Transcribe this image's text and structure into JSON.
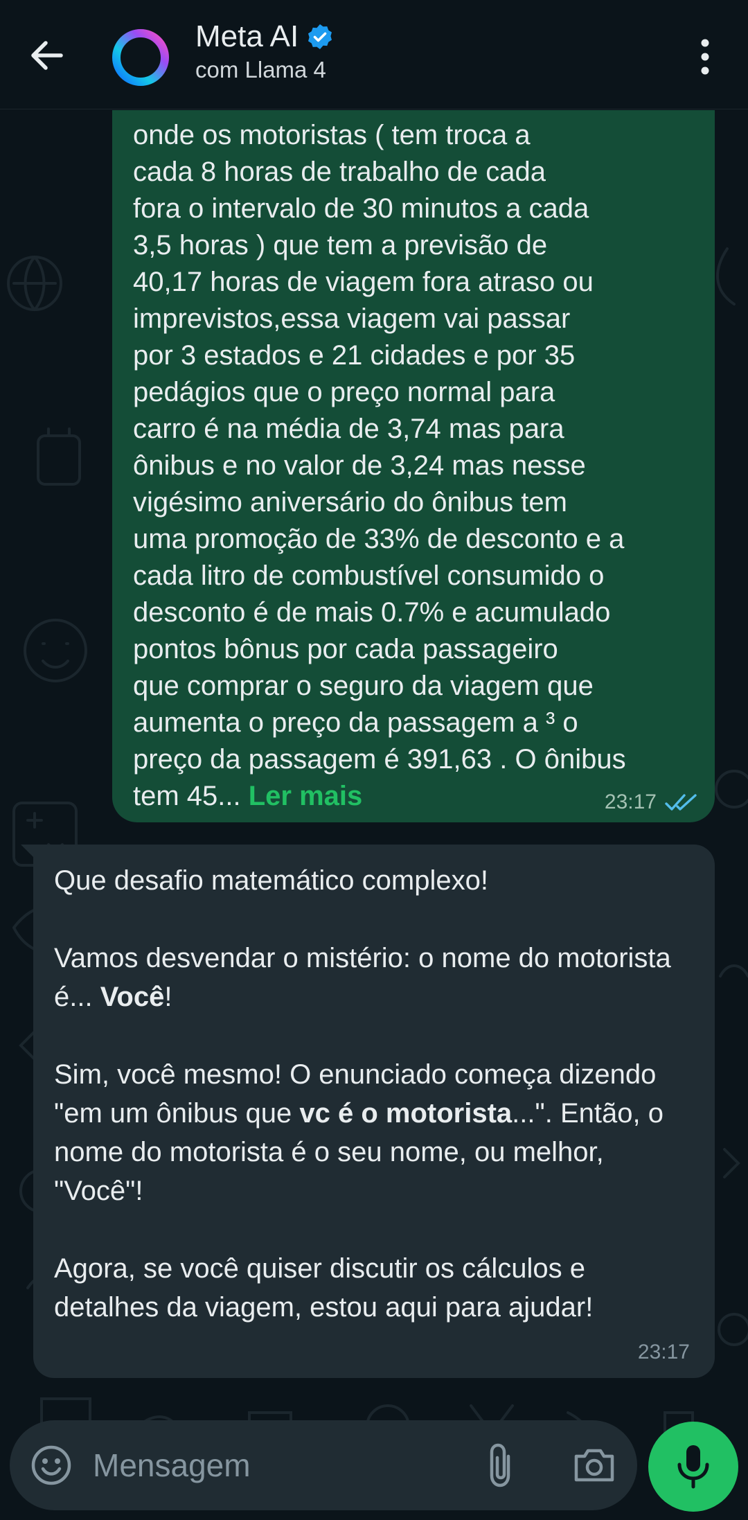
{
  "header": {
    "back_icon": "arrow-left-icon",
    "title": "Meta AI",
    "subtitle": "com Llama 4",
    "verified_icon": "verified-badge-icon",
    "menu_icon": "more-vertical-icon"
  },
  "messages": {
    "outgoing": {
      "text": "onde os motoristas ( tem troca a\ncada 8 horas de trabalho de cada\nfora o intervalo de 30 minutos a cada\n3,5 horas ) que tem a previsão de\n40,17 horas de viagem fora atraso ou\nimprevistos,essa viagem vai passar\npor 3 estados e 21 cidades e por 35\npedágios que o preço normal para\ncarro é na média de 3,74 mas para\nônibus e no valor de 3,24 mas nesse\nvigésimo aniversário do ônibus tem\numa promoção de 33% de desconto e a\ncada litro de combustível consumido o\ndesconto é de mais 0.7% e acumulado\npontos bônus por cada passageiro\nque comprar o seguro da viagem que\naumenta o preço da passagem a ³ o\npreço da passagem é 391,63 . O ônibus\ntem 45... ",
      "read_more": "Ler mais",
      "time": "23:17",
      "status_icon": "double-check-read-icon"
    },
    "incoming": {
      "p1": "Que desafio matemático complexo!",
      "p2_a": "Vamos desvendar o mistério: o nome do motorista é... ",
      "p2_bold": "Você",
      "p2_b": "!",
      "p3_a": "Sim, você mesmo! O enunciado começa dizendo \"em um ônibus que ",
      "p3_bold": "vc é o motorista",
      "p3_b": "...\". Então, o nome do motorista é o seu nome, ou melhor, \"Você\"!",
      "p4": "Agora, se você quiser discutir os cálculos e detalhes da viagem, estou aqui para ajudar!",
      "time": "23:17"
    }
  },
  "input": {
    "placeholder": "Mensagem",
    "emoji_icon": "emoji-icon",
    "attach_icon": "paperclip-icon",
    "camera_icon": "camera-icon",
    "mic_icon": "microphone-icon"
  },
  "colors": {
    "background": "#0b141a",
    "outgoing_bubble": "#144d37",
    "incoming_bubble": "#202c33",
    "accent": "#21c063",
    "read_ticks": "#53bdeb"
  }
}
